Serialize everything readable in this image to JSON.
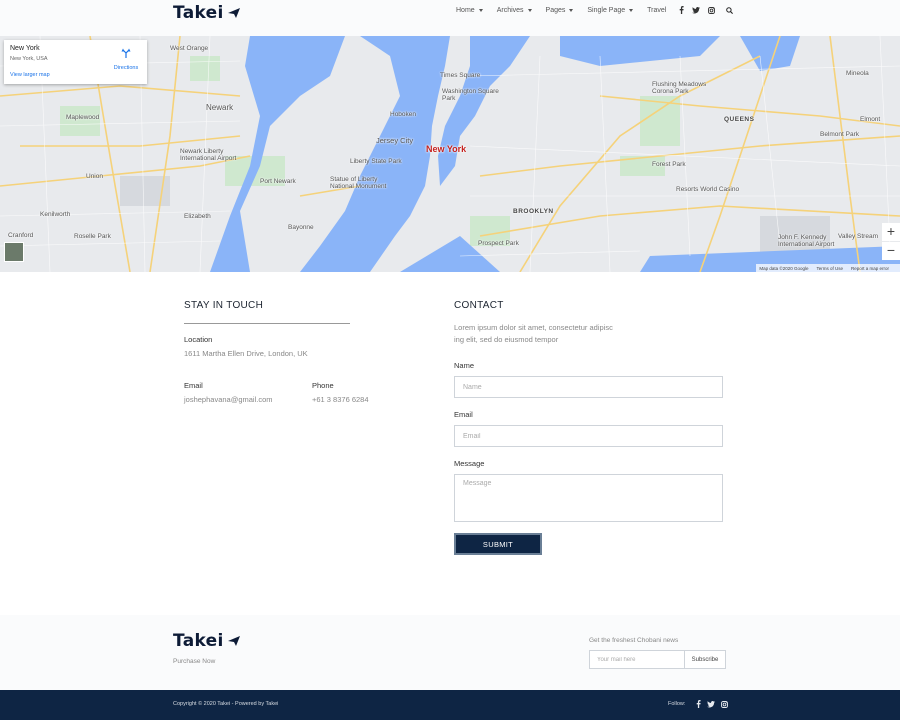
{
  "header": {
    "logo": "Takei",
    "nav": [
      {
        "label": "Home",
        "dropdown": true
      },
      {
        "label": "Archives",
        "dropdown": true
      },
      {
        "label": "Pages",
        "dropdown": true
      },
      {
        "label": "Single Page",
        "dropdown": true
      },
      {
        "label": "Travel",
        "dropdown": false
      }
    ],
    "icons": [
      "facebook-icon",
      "twitter-icon",
      "instagram-icon",
      "search-icon"
    ]
  },
  "map": {
    "card": {
      "title": "New York",
      "subtitle": "New York, USA",
      "larger_link": "View larger map",
      "directions": "Directions"
    },
    "city_label": "New York",
    "places": {
      "west_orange": "West Orange",
      "newark": "Newark",
      "jersey_city": "Jersey City",
      "union": "Union",
      "maplewood": "Maplewood",
      "kenilworth": "Kenilworth",
      "cranford": "Cranford",
      "queens": "QUEENS",
      "brooklyn": "BROOKLYN",
      "bayonne": "Bayonne",
      "hoboken": "Hoboken",
      "prospect_park": "Prospect Park",
      "forest_park": "Forest Park",
      "flushing": "Flushing Meadows Corona Park",
      "times_square": "Times Square",
      "kennedy": "John F. Kennedy International Airport",
      "valley_stream": "Valley Stream",
      "elmont": "Elmont",
      "roselle_park": "Roselle Park",
      "liberty_park": "Liberty State Park",
      "statue": "Statue of Liberty National Monument",
      "newark_airport": "Newark Liberty International Airport",
      "elizabeth": "Elizabeth",
      "wash_square": "Washington Square Park",
      "resorts": "Resorts World Casino",
      "belmont": "Belmont Park",
      "mineola": "Mineola",
      "port_newark": "Port Newark"
    },
    "zoom_in": "+",
    "zoom_out": "−",
    "footer": {
      "data": "Map data ©2020 Google",
      "terms": "Terms of Use",
      "report": "Report a map error"
    },
    "colors": {
      "water": "#8ab4f8",
      "land": "#e8eaed",
      "park": "#c8e6c9",
      "road": "#fde293"
    }
  },
  "touch": {
    "title": "STAY IN TOUCH",
    "location_label": "Location",
    "location_value": "1611 Martha Ellen Drive, London, UK",
    "email_label": "Email",
    "email_value": "joshephavana@gmail.com",
    "phone_label": "Phone",
    "phone_value": "+61 3 8376 6284"
  },
  "contact": {
    "title": "CONTACT",
    "intro": "Lorem ipsum dolor sit amet, consectetur adipisc ing elit, sed do eiusmod tempor",
    "name_label": "Name",
    "name_placeholder": "Name",
    "email_label": "Email",
    "email_placeholder": "Email",
    "message_label": "Message",
    "message_placeholder": "Message",
    "submit": "SUBMIT"
  },
  "footer": {
    "logo": "Takei",
    "purchase": "Purchase Now",
    "news_label": "Get the freshest Chobani news",
    "news_placeholder": "Your mail here",
    "subscribe": "Subscribe",
    "copyright": "Copyright © 2020 Takei - Powered by Takei",
    "follow": "Follow:"
  },
  "colors": {
    "navy": "#0e2544",
    "text_dark": "#1c2430",
    "muted": "#888888"
  }
}
